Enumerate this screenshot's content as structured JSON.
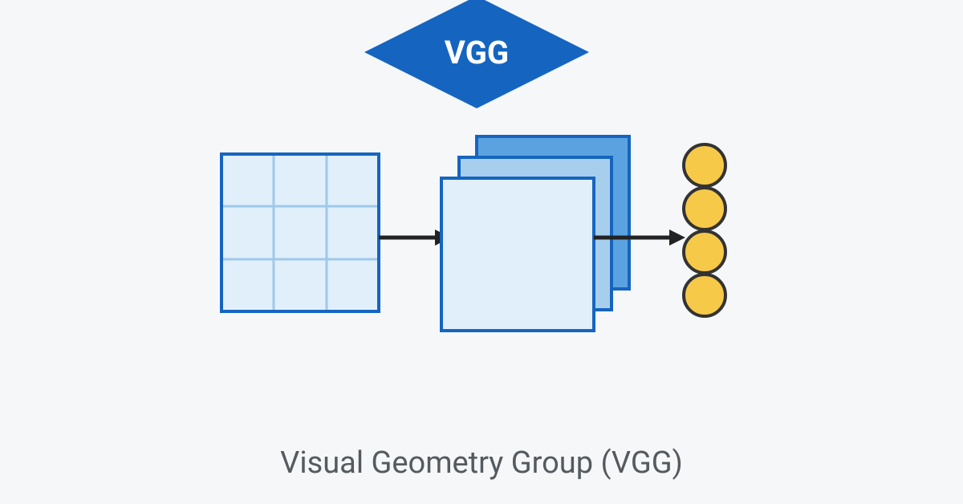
{
  "diamond": {
    "label": "VGG"
  },
  "caption": "Visual Geometry Group (VGG)",
  "colors": {
    "brand_blue": "#1565c0",
    "light_blue_1": "#5ba3e0",
    "light_blue_2": "#a8ceee",
    "light_blue_3": "#e1effb",
    "circle_fill": "#f7c948",
    "circle_stroke": "#333333",
    "bg": "#f5f7f9",
    "text_dark": "#555a5f"
  },
  "diagram": {
    "input_grid": {
      "rows": 3,
      "cols": 3
    },
    "conv_layers": 3,
    "output_nodes": 4
  }
}
